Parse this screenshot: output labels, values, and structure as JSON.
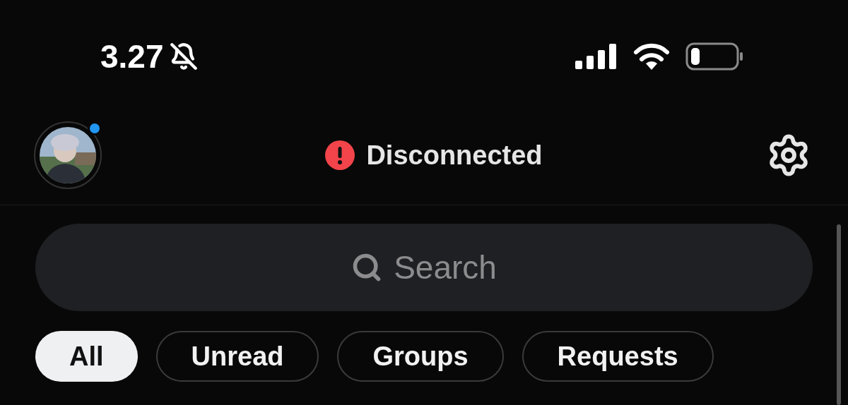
{
  "status_bar": {
    "time": "3.27",
    "silenced": true
  },
  "header": {
    "avatar": {
      "kind": "picture",
      "online": true
    },
    "connection": {
      "label": "Disconnected",
      "error": true
    }
  },
  "search": {
    "placeholder": "Search"
  },
  "filters": [
    {
      "label": "All",
      "selected": true
    },
    {
      "label": "Unread",
      "selected": false
    },
    {
      "label": "Groups",
      "selected": false
    },
    {
      "label": "Requests",
      "selected": false
    }
  ]
}
